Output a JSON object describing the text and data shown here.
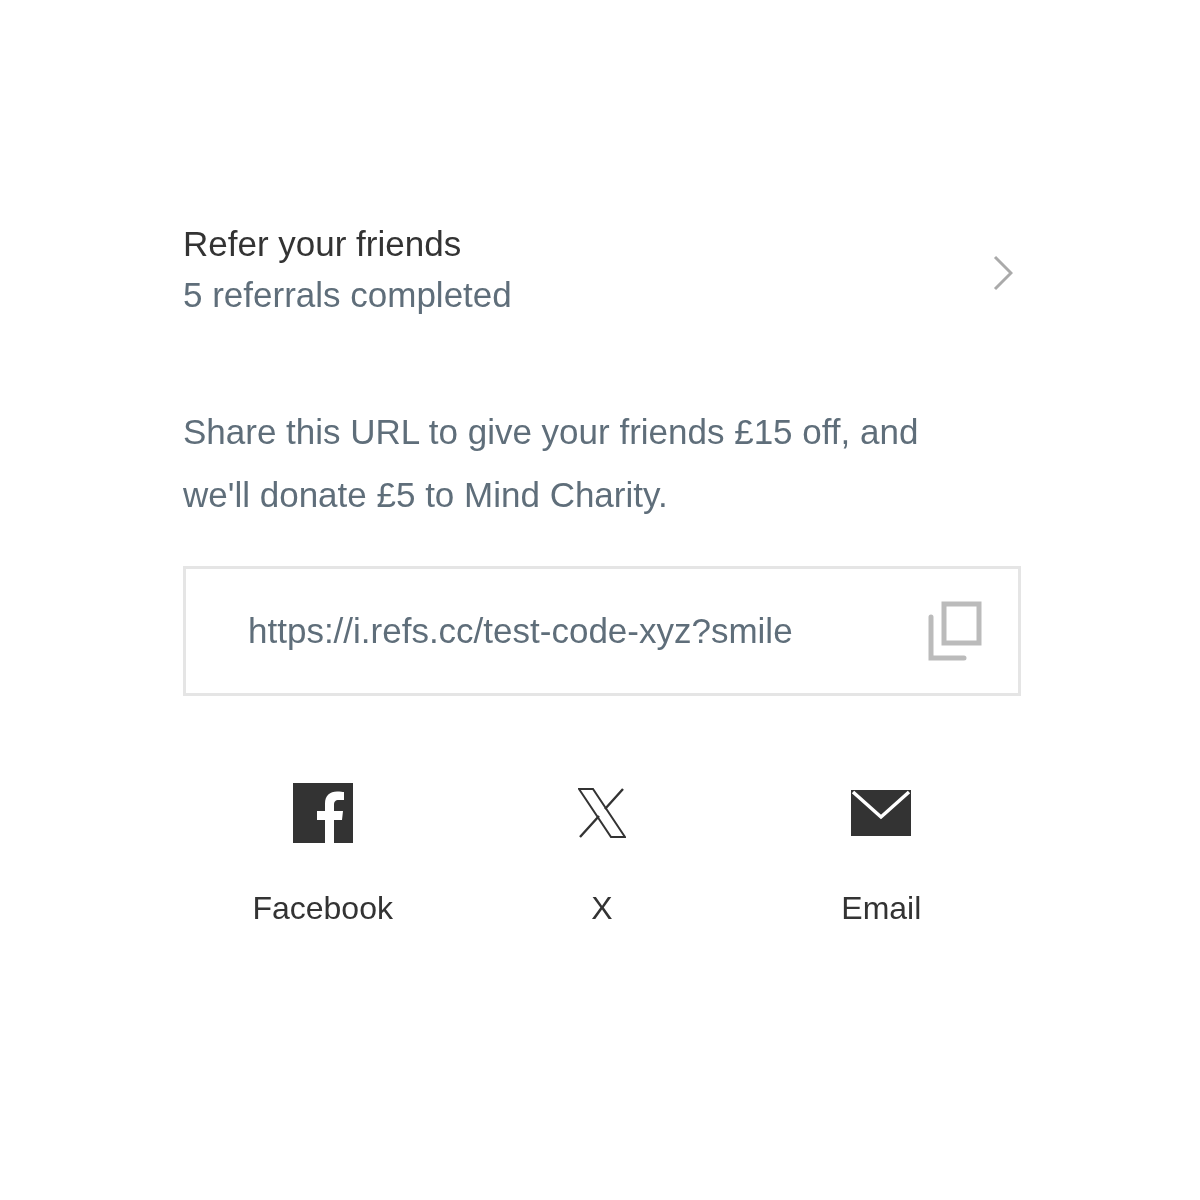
{
  "referral": {
    "title": "Refer your friends",
    "subtitle": "5 referrals completed"
  },
  "description": "Share this URL to give your friends £15 off, and we'll donate £5 to Mind Charity.",
  "url_field": {
    "value": "https://i.refs.cc/test-code-xyz?smile"
  },
  "share_options": [
    {
      "kind": "facebook",
      "label": "Facebook"
    },
    {
      "kind": "x",
      "label": "X"
    },
    {
      "kind": "email",
      "label": "Email"
    }
  ]
}
